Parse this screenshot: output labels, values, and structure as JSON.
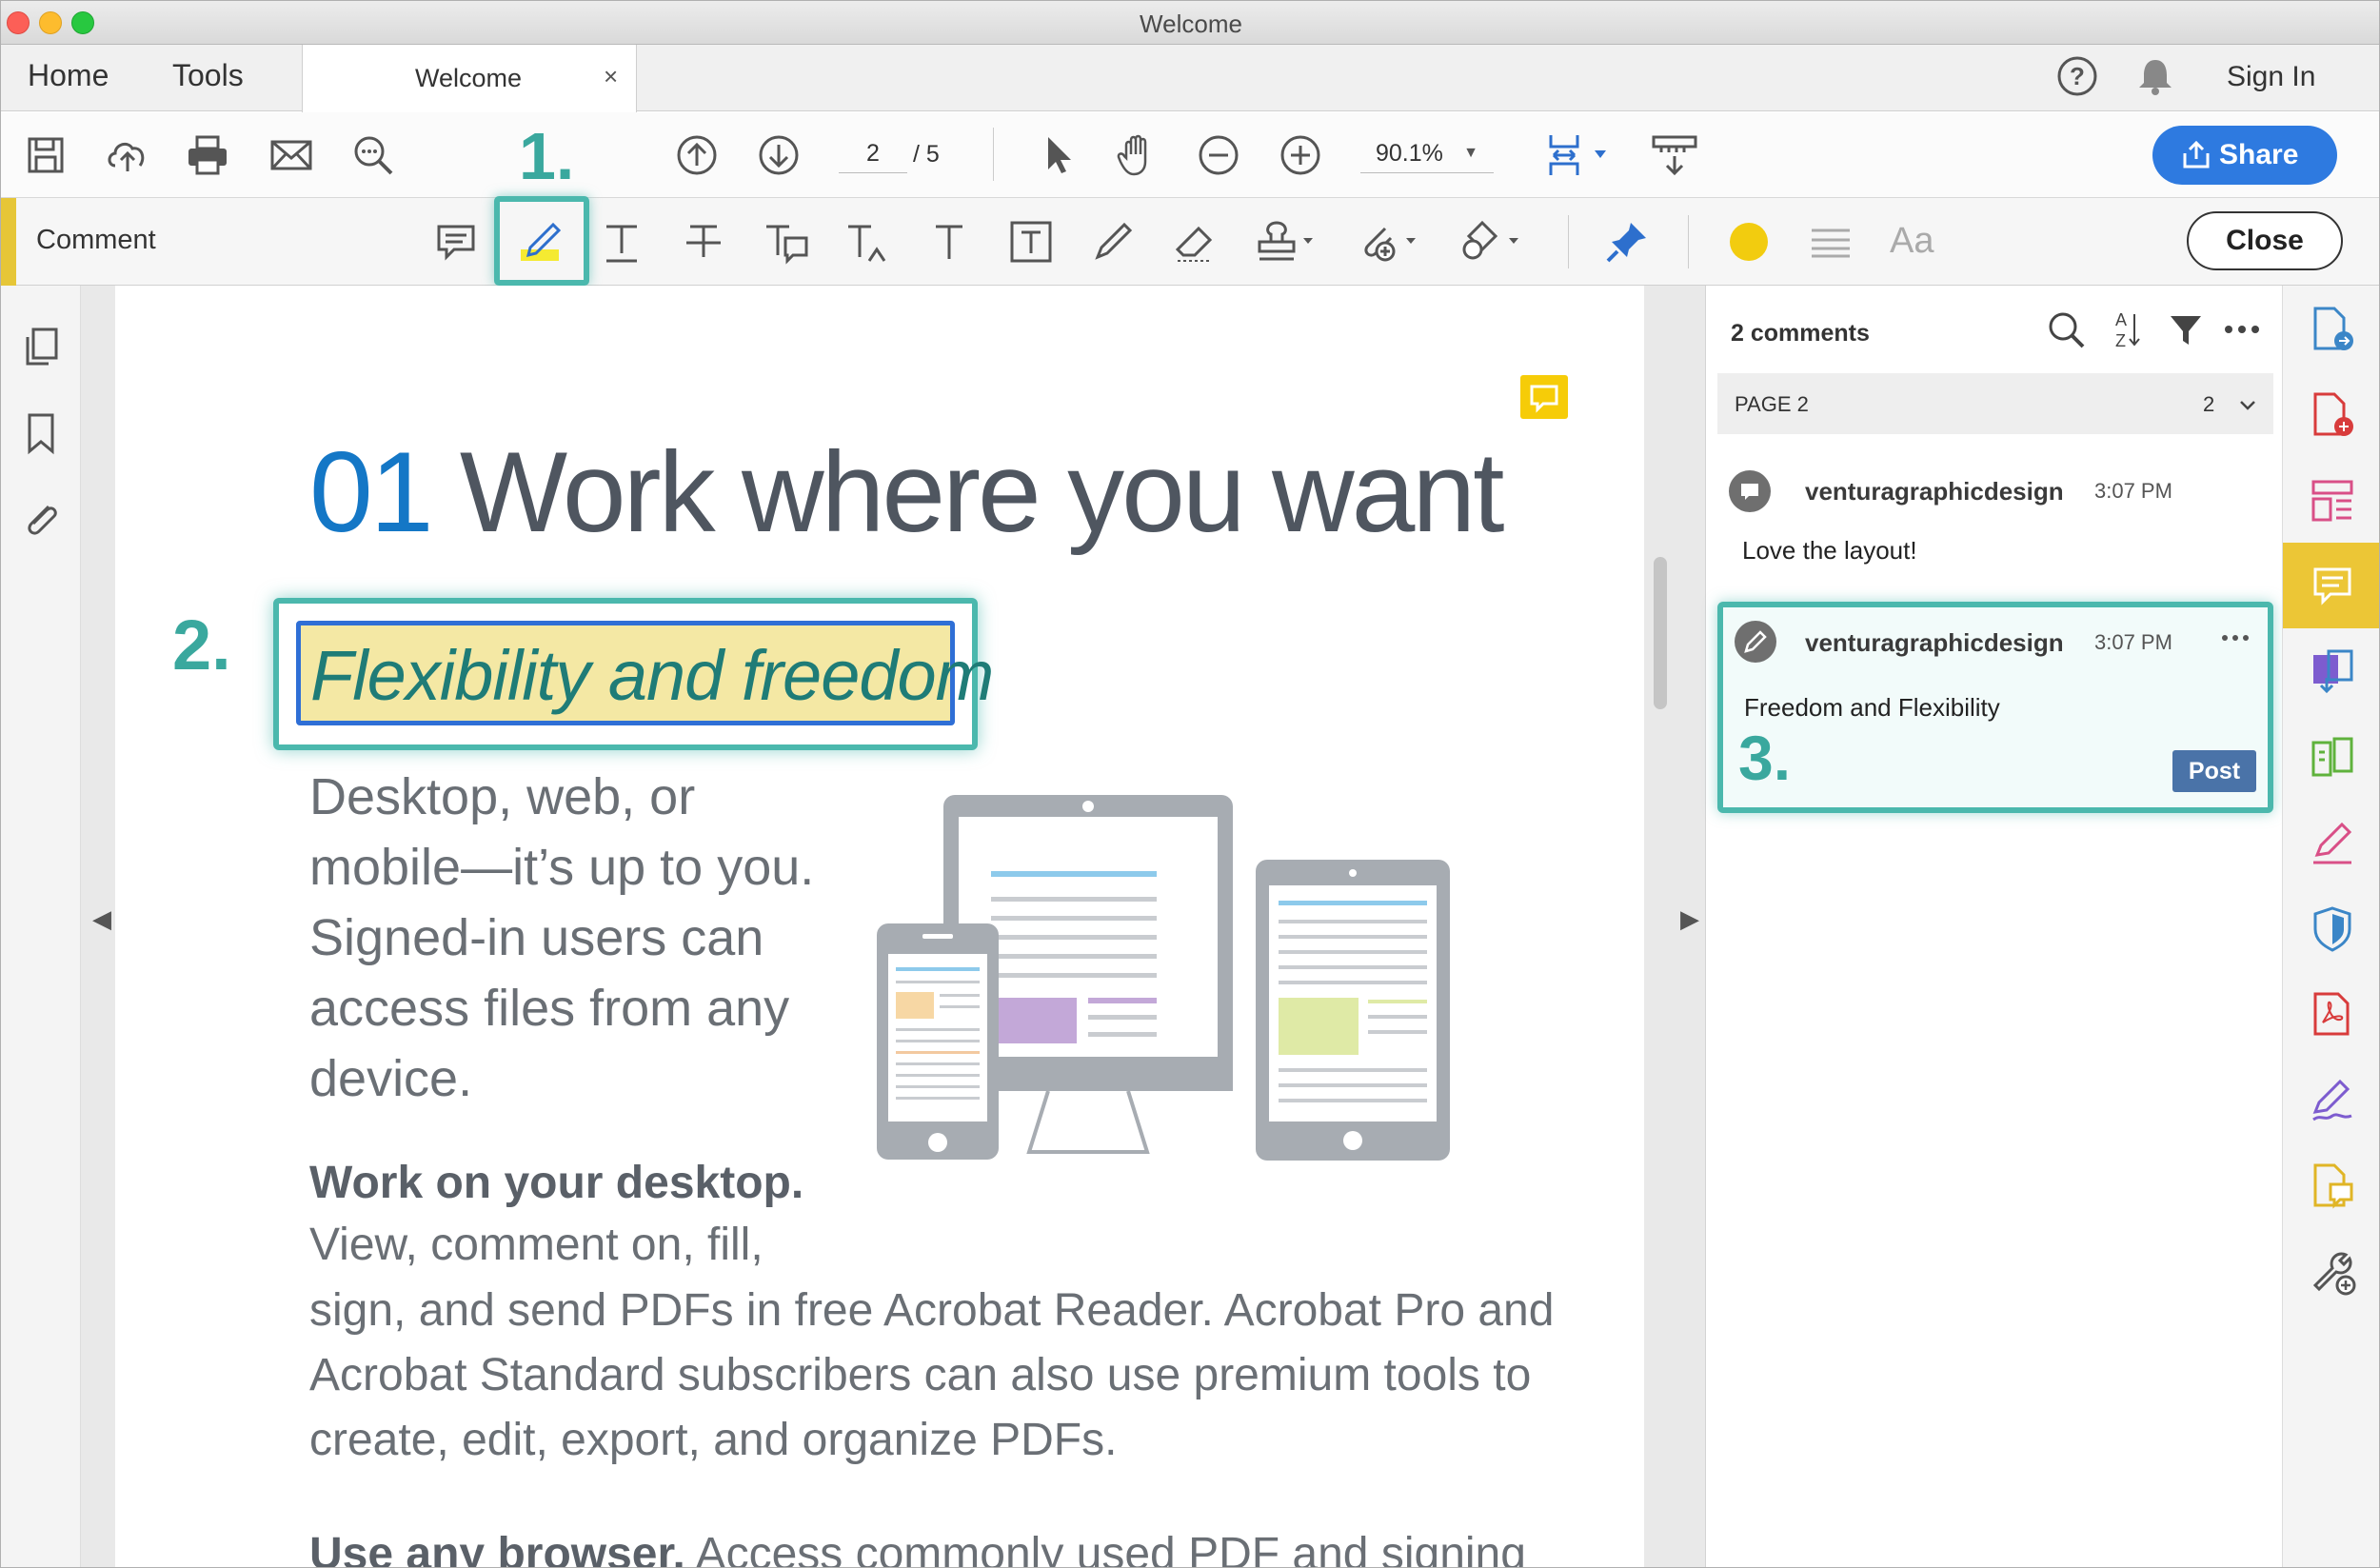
{
  "window": {
    "title": "Welcome"
  },
  "tabs": {
    "home": "Home",
    "tools": "Tools",
    "doc_tab": "Welcome",
    "close_glyph": "×",
    "sign_in": "Sign In"
  },
  "toolbar": {
    "page_current": "2",
    "page_total": "/ 5",
    "zoom": "90.1%",
    "share_label": "Share"
  },
  "comment_toolbar": {
    "title": "Comment",
    "close_label": "Close",
    "color_swatch": "#f2cc0f"
  },
  "annotations": {
    "step1": "1.",
    "step2": "2.",
    "step3": "3.",
    "teal": "#4bb8ad"
  },
  "document": {
    "heading_num": "01",
    "heading_text": "Work where you want",
    "highlight_text": "Flexibility and freedom",
    "para1": "Desktop, web, or mobile—it’s up to you. Signed-in users can access files from any device.",
    "subhead": "Work on your desktop.",
    "para2a": "View, comment on, fill,",
    "para2": "sign, and send PDFs in free Acrobat Reader. Acrobat Pro and Acrobat Standard subscribers can also use premium tools to create, edit, export, and organize PDFs.",
    "para3_bold": "Use any browser.",
    "para3": " Access commonly used PDF and signing"
  },
  "comments_pane": {
    "count_label": "2 comments",
    "page_label": "PAGE 2",
    "page_count": "2",
    "comments": [
      {
        "user": "venturagraphicdesign",
        "time": "3:07 PM",
        "text": "Love the layout!"
      },
      {
        "user": "venturagraphicdesign",
        "time": "3:07 PM",
        "text": "Freedom and Flexibility",
        "action": "Post"
      }
    ]
  },
  "colors": {
    "accent_blue": "#2e7ae0",
    "acrobat_red": "#d83b3b",
    "comment_yellow": "#ecc636"
  }
}
